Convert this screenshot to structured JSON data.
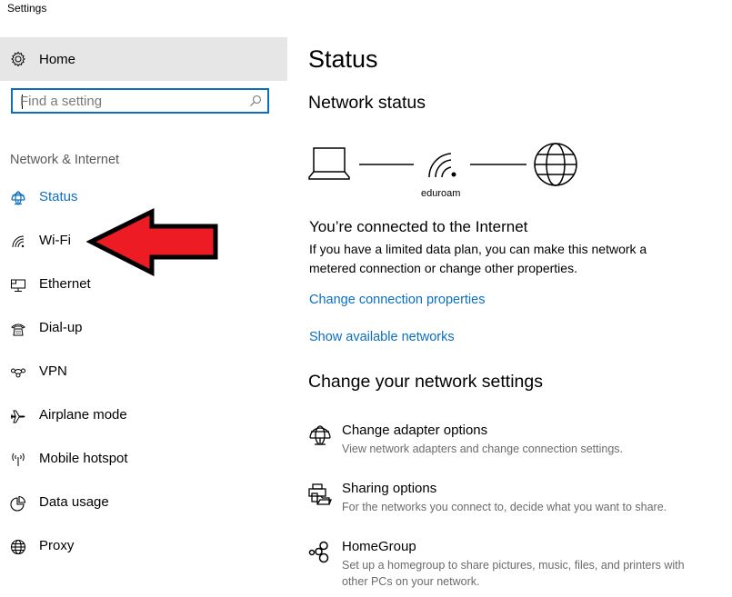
{
  "window": {
    "title": "Settings"
  },
  "sidebar": {
    "home": {
      "label": "Home",
      "icon": "gear-icon"
    },
    "search": {
      "placeholder": "Find a setting",
      "value": "",
      "icon": "search-icon"
    },
    "section_label": "Network & Internet",
    "items": [
      {
        "label": "Status",
        "icon": "status-globe-icon",
        "active": true
      },
      {
        "label": "Wi-Fi",
        "icon": "wifi-icon",
        "active": false
      },
      {
        "label": "Ethernet",
        "icon": "ethernet-icon",
        "active": false
      },
      {
        "label": "Dial-up",
        "icon": "phone-icon",
        "active": false
      },
      {
        "label": "VPN",
        "icon": "vpn-icon",
        "active": false
      },
      {
        "label": "Airplane mode",
        "icon": "airplane-icon",
        "active": false
      },
      {
        "label": "Mobile hotspot",
        "icon": "hotspot-icon",
        "active": false
      },
      {
        "label": "Data usage",
        "icon": "pie-chart-icon",
        "active": false
      },
      {
        "label": "Proxy",
        "icon": "globe-icon",
        "active": false
      }
    ]
  },
  "main": {
    "title": "Status",
    "network_status": {
      "heading": "Network status",
      "ssid": "eduroam",
      "connection_title": "You’re connected to the Internet",
      "description_line1": "If you have a limited data plan, you can make this network a",
      "description_line2": "metered connection or change other properties.",
      "links": [
        "Change connection properties",
        "Show available networks"
      ]
    },
    "change_settings": {
      "heading": "Change your network settings",
      "items": [
        {
          "title": "Change adapter options",
          "description": "View network adapters and change connection settings.",
          "icon": "adapter-icon"
        },
        {
          "title": "Sharing options",
          "description": "For the networks you connect to, decide what you want to share.",
          "icon": "sharing-icon"
        },
        {
          "title": "HomeGroup",
          "description": "Set up a homegroup to share pictures, music, files, and printers with other PCs on your network.",
          "icon": "homegroup-icon"
        }
      ]
    }
  },
  "annotation": {
    "type": "red-arrow",
    "points_to": "Wi-Fi",
    "color": "#ed1c24"
  }
}
